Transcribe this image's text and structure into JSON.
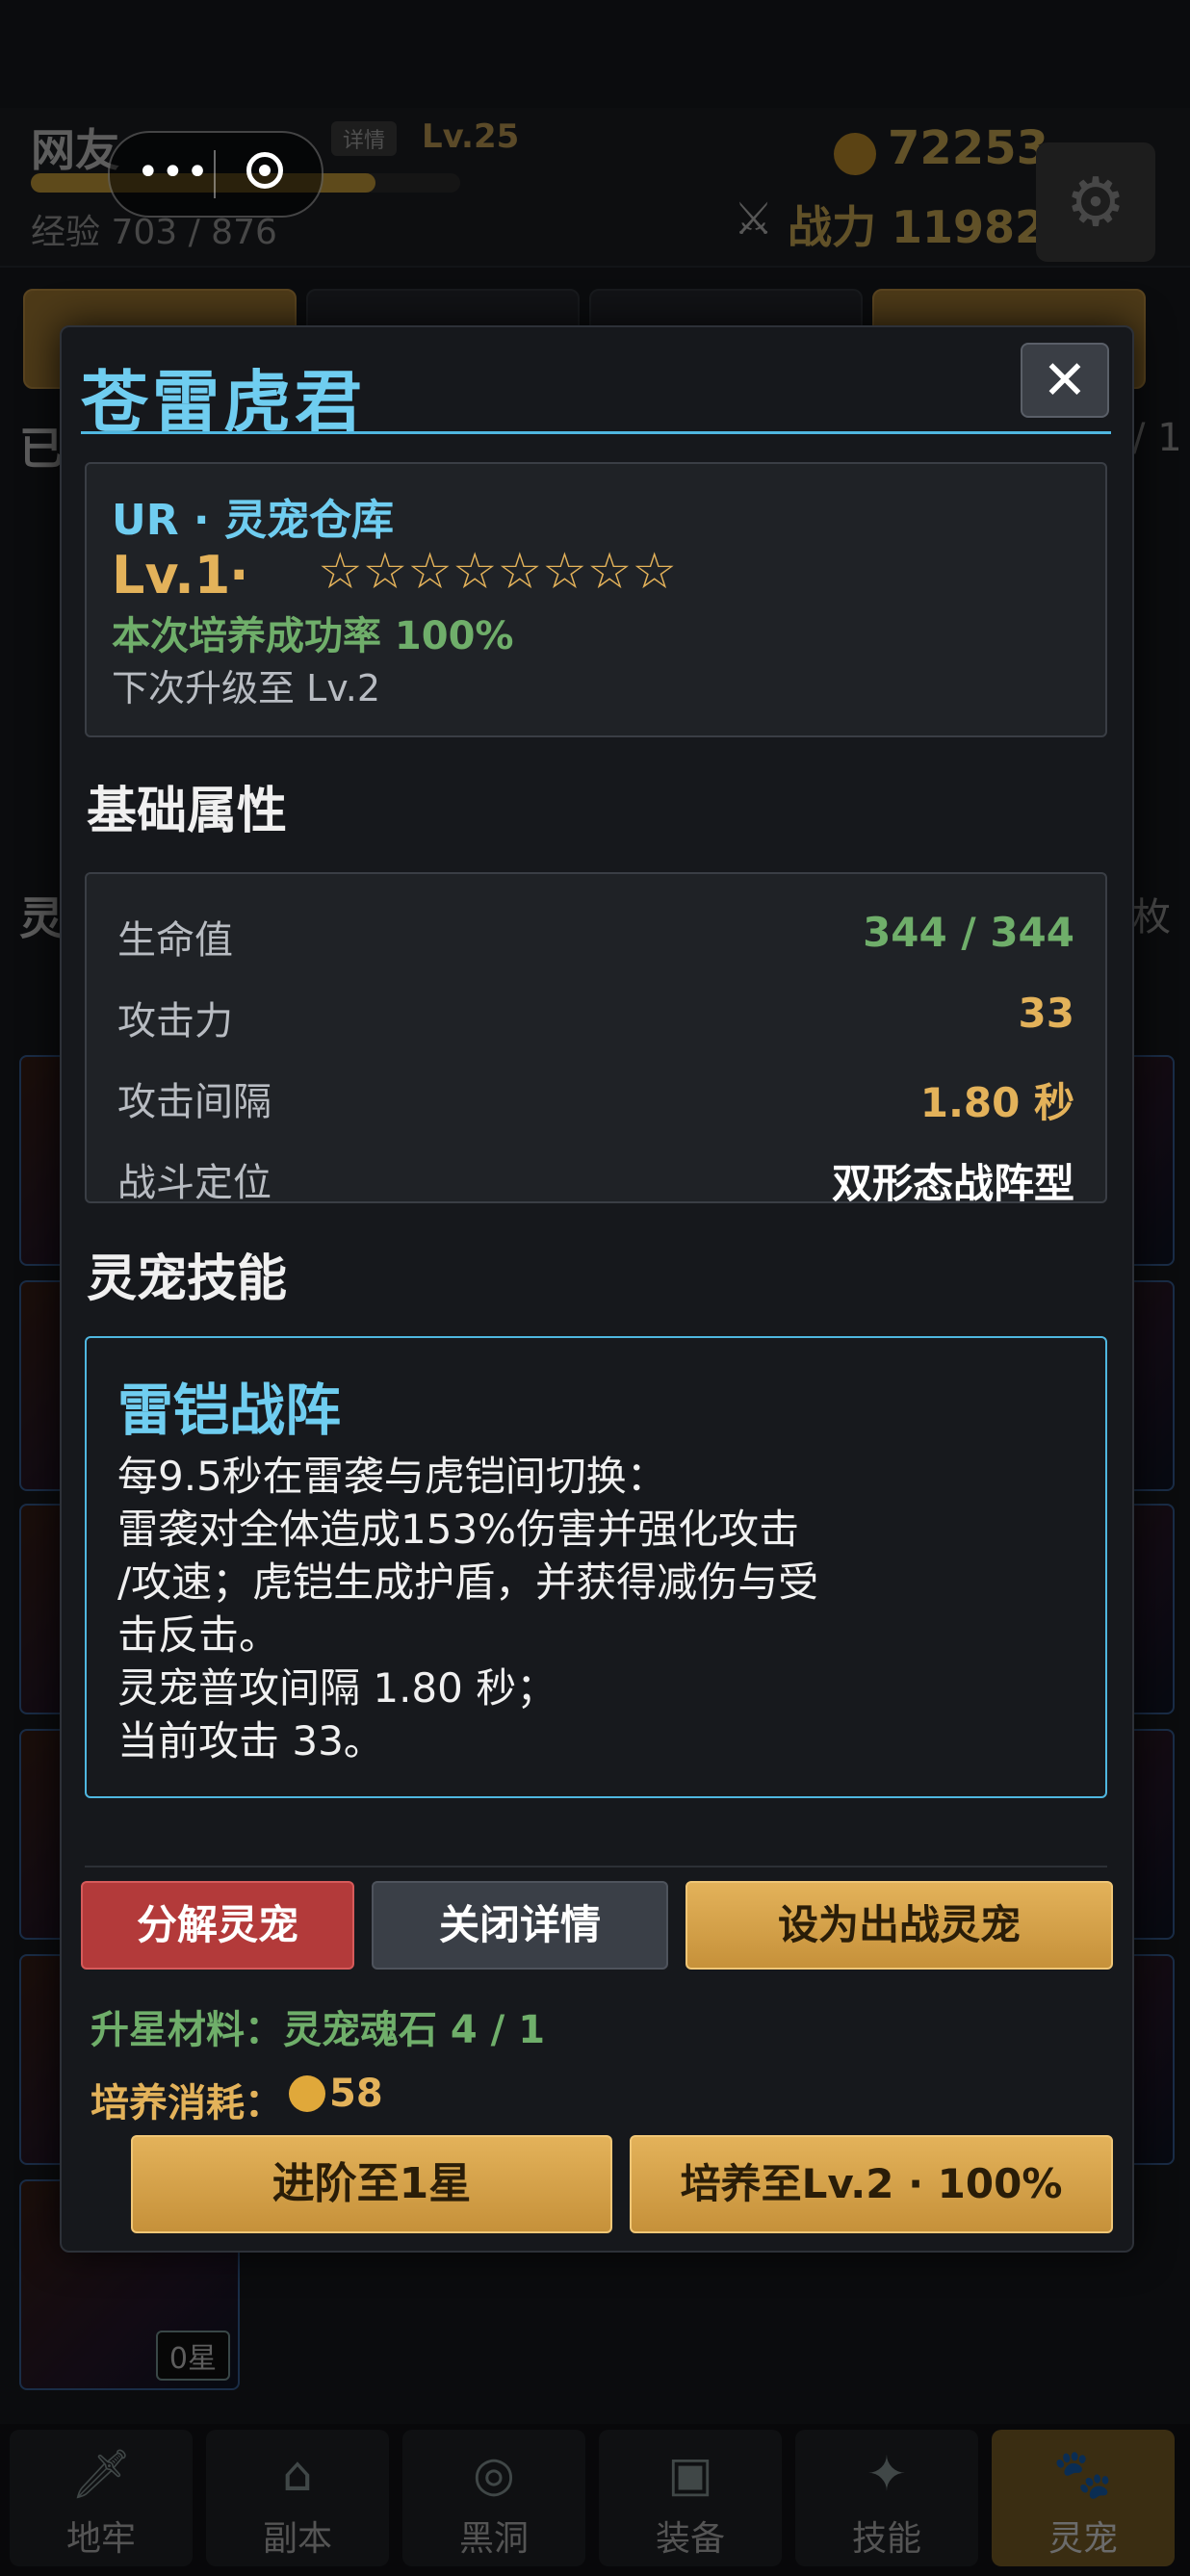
{
  "header": {
    "player_name": "网友",
    "detail_tag": "详情",
    "level": "Lv.25",
    "exp_text": "经验 703 / 876",
    "exp_fraction": 0.803,
    "coins": "72253",
    "power": "战力 11982"
  },
  "capsule": {
    "menu_icon": "more-dots-icon",
    "close_icon": "target-icon"
  },
  "background": {
    "side_cut_label_1": "已",
    "side_cut_label_2": "灵",
    "side_cut_right_1": "/ 1",
    "side_cut_right_2": "枚",
    "card_star_label": "0星"
  },
  "nav": {
    "items": [
      {
        "label": "地牢",
        "icon": "sword-icon"
      },
      {
        "label": "副本",
        "icon": "temple-icon"
      },
      {
        "label": "黑洞",
        "icon": "vortex-icon"
      },
      {
        "label": "装备",
        "icon": "backpack-icon"
      },
      {
        "label": "技能",
        "icon": "star-burst-icon"
      },
      {
        "label": "灵宠",
        "icon": "paw-icon"
      }
    ]
  },
  "modal": {
    "title": "苍雷虎君",
    "close_label": "✕",
    "summary": {
      "rarity_line": "UR · 灵宠仓库",
      "level": "Lv.1",
      "dot": "·",
      "stars": "☆☆☆☆☆☆☆☆",
      "success_rate": "本次培养成功率  100%",
      "next_level": "下次升级至 Lv.2"
    },
    "attributes": {
      "title": "基础属性",
      "rows": [
        {
          "label": "生命值",
          "value": "344 / 344"
        },
        {
          "label": "攻击力",
          "value": "33"
        },
        {
          "label": "攻击间隔",
          "value": "1.80 秒"
        },
        {
          "label": "战斗定位",
          "value": "双形态战阵型"
        }
      ]
    },
    "skills": {
      "title": "灵宠技能",
      "skill_name": "雷铠战阵",
      "lines": [
        "每9.5秒在雷袭与虎铠间切换：",
        "雷袭对全体造成153%伤害并强化攻击",
        "/攻速；虎铠生成护盾，并获得减伤与受",
        "击反击。",
        "灵宠普攻间隔 1.80 秒；",
        "当前攻击 33。"
      ]
    },
    "actions": {
      "decompose": "分解灵宠",
      "close_detail": "关闭详情",
      "set_battle": "设为出战灵宠"
    },
    "materials": "升星材料：灵宠魂石 4 / 1",
    "cost_label": "培养消耗：",
    "cost_value": "58",
    "advance_button": "进阶至1星",
    "train_button": "培养至Lv.2 · 100%"
  },
  "colors": {
    "title_blue": "#6fcdf0",
    "gold": "#e3b25a",
    "green": "#6fae6a",
    "red_button": "#b33a3a"
  }
}
